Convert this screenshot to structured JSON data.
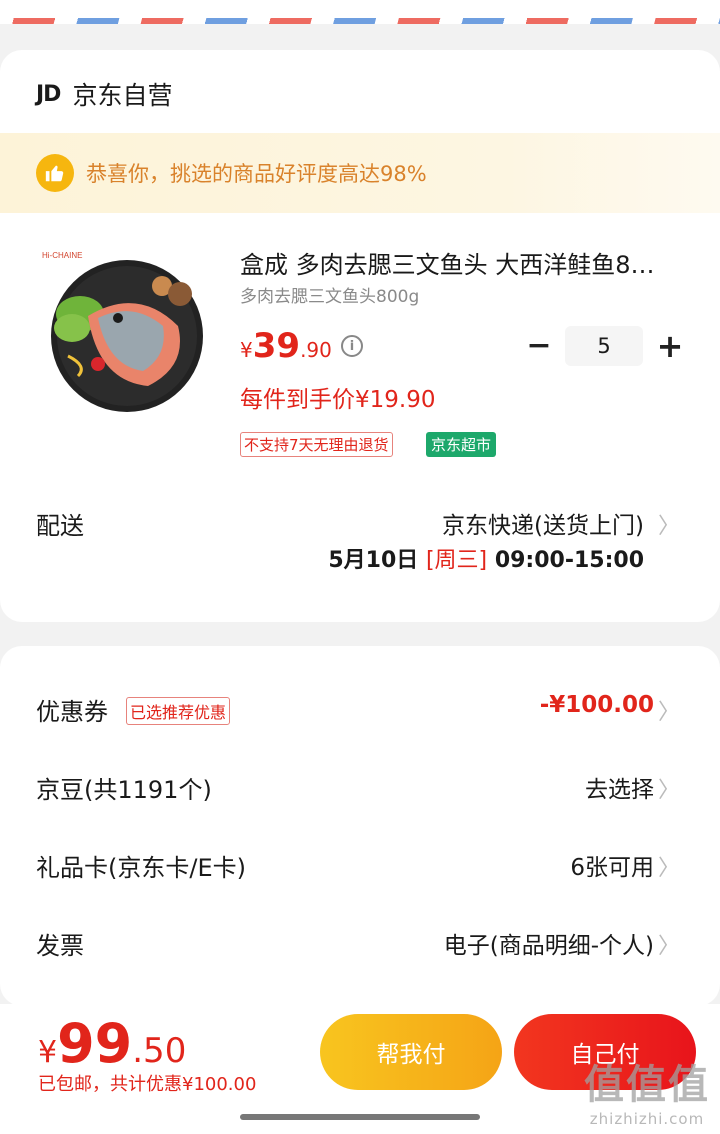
{
  "shop": {
    "logo": "JD",
    "name": "京东自营"
  },
  "praise": {
    "icon": "thumbs-up-icon",
    "text": "恭喜你，挑选的商品好评度高达98%"
  },
  "product": {
    "title": "盒成 多肉去腮三文鱼头 大西洋鲑鱼8…",
    "spec": "多肉去腮三文鱼头800g",
    "price_yen": "¥",
    "price_int": "39",
    "price_dec": ".90",
    "quantity": "5",
    "final_price": "每件到手价¥19.90",
    "tag_return": "不支持7天无理由退货",
    "tag_market": "京东超市",
    "image_brand": "Hi-CHAINE"
  },
  "delivery": {
    "label": "配送",
    "method": "京东快递(送货上门)",
    "date": "5月10日",
    "weekday": "[周三]",
    "time": "09:00-15:00"
  },
  "coupon": {
    "label": "优惠券",
    "tag": "已选推荐优惠",
    "value": "-¥100.00"
  },
  "beans": {
    "label": "京豆(共1191个)",
    "value": "去选择"
  },
  "giftcard": {
    "label": "礼品卡(京东卡/E卡)",
    "value": "6张可用"
  },
  "invoice": {
    "label": "发票",
    "value": "电子(商品明细-个人)"
  },
  "footer": {
    "yen": "¥",
    "total_int": "99",
    "total_dec": ".50",
    "free_shipping": "已包邮",
    "saving": "，共计优惠¥100.00",
    "help_pay": "帮我付",
    "self_pay": "自己付"
  },
  "watermark": {
    "big": "值值值",
    "small": "zhizhizhi.com"
  },
  "colors": {
    "accent_red": "#e1251b",
    "praise_orange": "#d9822b",
    "help_yellow": "#f5a416",
    "market_green": "#1da86b"
  }
}
